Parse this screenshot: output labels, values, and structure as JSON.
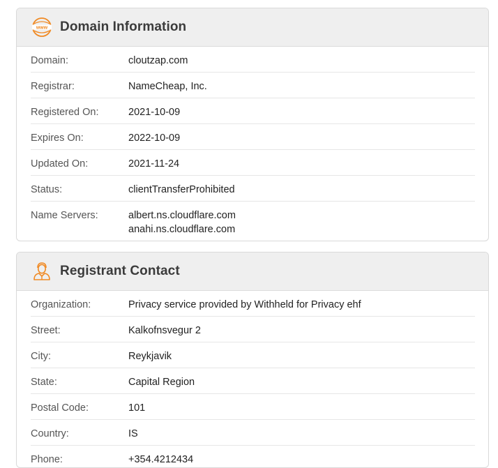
{
  "domain_info": {
    "title": "Domain Information",
    "icon": "www-globe-icon",
    "accent_color": "#f08a24",
    "rows": [
      {
        "label": "Domain:",
        "value": "cloutzap.com"
      },
      {
        "label": "Registrar:",
        "value": "NameCheap, Inc."
      },
      {
        "label": "Registered On:",
        "value": "2021-10-09"
      },
      {
        "label": "Expires On:",
        "value": "2022-10-09"
      },
      {
        "label": "Updated On:",
        "value": "2021-11-24"
      },
      {
        "label": "Status:",
        "value": "clientTransferProhibited"
      }
    ],
    "name_servers": {
      "label": "Name Servers:",
      "values": [
        "albert.ns.cloudflare.com",
        "anahi.ns.cloudflare.com"
      ]
    }
  },
  "registrant": {
    "title": "Registrant Contact",
    "icon": "person-icon",
    "accent_color": "#f08a24",
    "rows": [
      {
        "label": "Organization:",
        "value": "Privacy service provided by Withheld for Privacy ehf"
      },
      {
        "label": "Street:",
        "value": "Kalkofnsvegur 2"
      },
      {
        "label": "City:",
        "value": "Reykjavik"
      },
      {
        "label": "State:",
        "value": "Capital Region"
      },
      {
        "label": "Postal Code:",
        "value": "101"
      },
      {
        "label": "Country:",
        "value": "IS"
      },
      {
        "label": "Phone:",
        "value": "+354.4212434"
      }
    ]
  }
}
